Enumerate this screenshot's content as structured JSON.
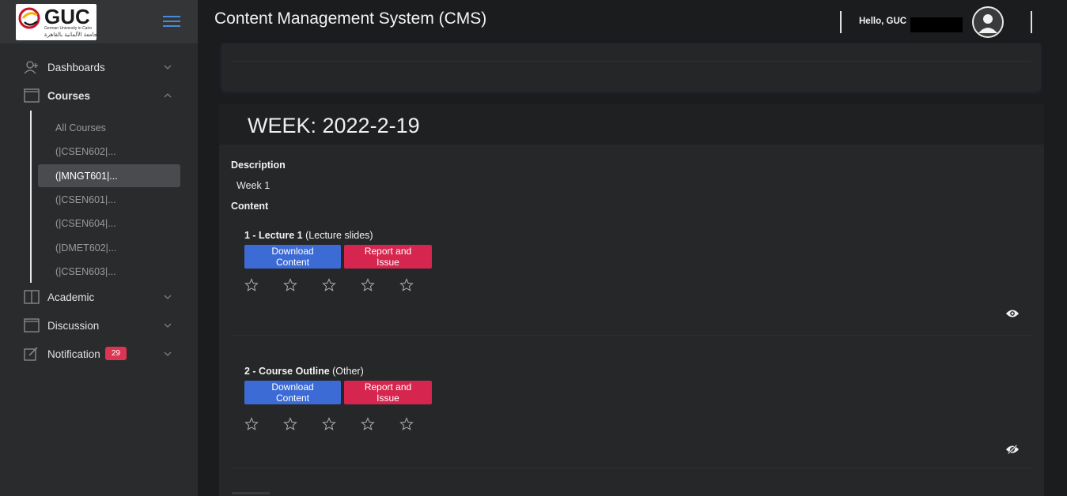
{
  "brand": {
    "logo_text": "GUC",
    "logo_sub": "German University in Cairo",
    "logo_arabic": "الجامعة الألمانية بالقاهرة"
  },
  "header": {
    "title": "Content Management System (CMS)",
    "greeting": "Hello, GUC"
  },
  "sidebar": {
    "items": [
      {
        "label": "Dashboards",
        "icon": "user-plus-icon"
      },
      {
        "label": "Courses",
        "icon": "window-icon"
      },
      {
        "label": "Academic",
        "icon": "book-icon"
      },
      {
        "label": "Discussion",
        "icon": "window-icon"
      },
      {
        "label": "Notification",
        "icon": "edit-icon",
        "badge": "29"
      }
    ],
    "courses_sub": [
      "All Courses",
      "(|CSEN602|...",
      "(|MNGT601|...",
      "(|CSEN601|...",
      "(|CSEN604|...",
      "(|DMET602|...",
      "(|CSEN603|..."
    ]
  },
  "week": {
    "title": "WEEK: 2022-2-19",
    "description_label": "Description",
    "description": "Week 1",
    "content_label": "Content"
  },
  "contents": [
    {
      "title": "1 - Lecture 1",
      "type": "(Lecture slides)",
      "download": "Download Content",
      "report": "Report and Issue",
      "eye": "eye-icon"
    },
    {
      "title": "2 - Course Outline",
      "type": "(Other)",
      "download": "Download Content",
      "report": "Report and Issue",
      "eye": "eye-slash-icon"
    }
  ],
  "colors": {
    "accent_blue": "#3d6bd6",
    "accent_red": "#d6264f",
    "badge": "#dc3553",
    "sidebar_bg": "#2a2b2d"
  }
}
